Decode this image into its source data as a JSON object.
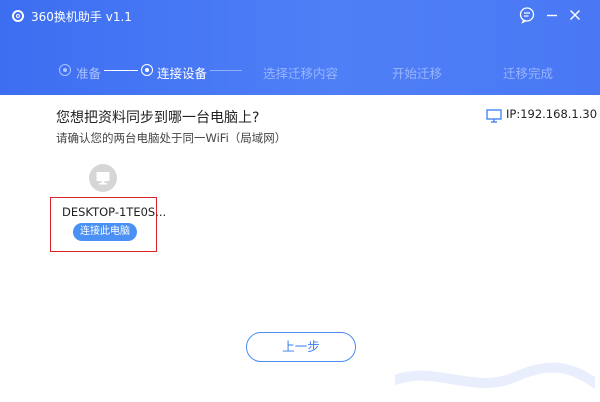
{
  "app": {
    "title": "360换机助手 v1.1"
  },
  "steps": [
    {
      "label": "准备",
      "state": "done"
    },
    {
      "label": "连接设备",
      "state": "active"
    },
    {
      "label": "选择迁移内容",
      "state": "future"
    },
    {
      "label": "开始迁移",
      "state": "future"
    },
    {
      "label": "迁移完成",
      "state": "future"
    }
  ],
  "main": {
    "question": "您想把资料同步到哪一台电脑上?",
    "hint": "请确认您的两台电脑处于同一WiFi（局域网）",
    "ip": "IP:192.168.1.30",
    "device": {
      "name": "DESKTOP-1TE0S...",
      "connect_label": "连接此电脑"
    },
    "prev_label": "上一步"
  },
  "colors": {
    "header": "#4a78f5",
    "accent": "#4a90f5",
    "highlight_border": "#d8232a"
  },
  "icons": [
    "app-logo-icon",
    "feedback-icon",
    "minimize-icon",
    "close-icon",
    "monitor-icon",
    "ip-monitor-icon"
  ]
}
